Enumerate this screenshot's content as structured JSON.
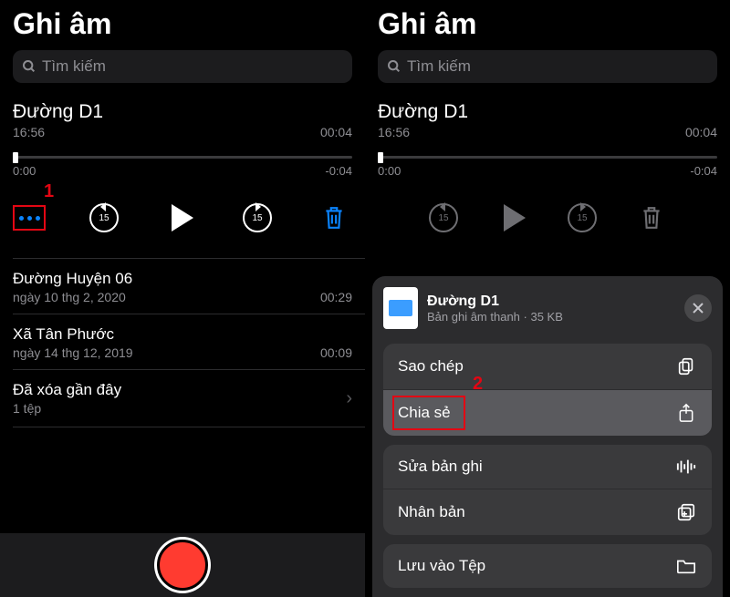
{
  "app_title": "Ghi âm",
  "search_placeholder": "Tìm kiếm",
  "current": {
    "name": "Đường D1",
    "time": "16:56",
    "duration": "00:04",
    "track_start": "0:00",
    "track_end": "-0:04"
  },
  "seek_amount": "15",
  "step1_label": "1",
  "step2_label": "2",
  "list": [
    {
      "name": "Đường Huyện 06",
      "date": "ngày 10 thg 2, 2020",
      "dur": "00:29"
    },
    {
      "name": "Xã Tân Phước",
      "date": "ngày 14 thg 12, 2019",
      "dur": "00:09"
    }
  ],
  "deleted": {
    "title": "Đã xóa gần đây",
    "sub": "1 tệp"
  },
  "sheet": {
    "title": "Đường D1",
    "subtitle": "Bản ghi âm thanh · 35 KB",
    "items": {
      "copy": "Sao chép",
      "share": "Chia sẻ",
      "edit": "Sửa bản ghi",
      "duplicate": "Nhân bản",
      "save": "Lưu vào Tệp"
    }
  }
}
